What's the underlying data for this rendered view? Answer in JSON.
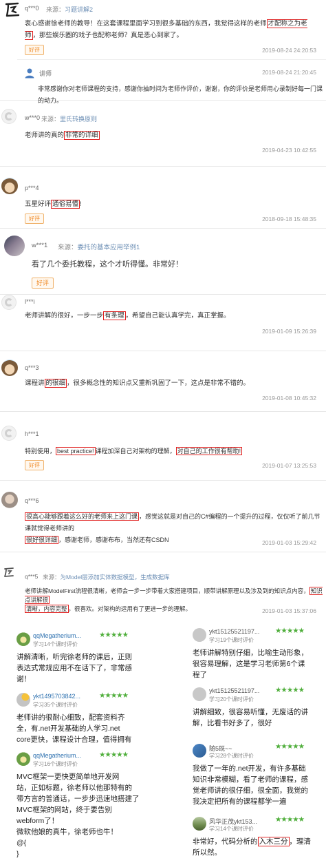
{
  "reviews": [
    {
      "nick": "q***0",
      "source_prefix": "来源：",
      "source_course": "习题讲解2",
      "content": [
        "衷心感谢徐老师的教导！在这套课程里面学习到很多基础的东西，我觉得这样的老师",
        "才配称之为老师",
        "，那些娱乐圈的戏子也配称老师？真是恶心到家了。"
      ],
      "badge": "好评",
      "date": "2019-08-24 24:20:53",
      "reply": {
        "author": "讲师",
        "content": "非常感谢你对老师课程的支持，感谢你抽时间为老师作评价，谢谢，你的评价是老师用心录制好每一门课的动力。",
        "date": "2019-08-24 21:20:45"
      }
    },
    {
      "nick": "w***0",
      "source_prefix": "来源：",
      "source_course": "里氏转换原则",
      "content": [
        "老师讲的真的",
        "非常的详细",
        ""
      ],
      "date": "2019-04-23 10:42:55"
    },
    {
      "nick": "p***4",
      "content": [
        "五星好评",
        "通俗易懂",
        "!"
      ],
      "badge": "好评",
      "date": "2018-09-18 15:48:35"
    },
    {
      "nick": "w***1",
      "source_prefix": "来源：",
      "source_course": "委托的基本应用举例1",
      "content": [
        "看了几个委托教程，这个才听得懂。非常好！"
      ],
      "badge": "好评"
    },
    {
      "nick": "l***i",
      "content": [
        "老师讲解的很好，一步一步",
        "有条理",
        "，希望自己能认真学完，真正掌握。"
      ],
      "date": "2019-01-09 15:26:39"
    },
    {
      "nick": "q***3",
      "content": [
        "课程讲",
        "的很细",
        "，很多概念性的知识点又重新巩固了一下，这点是非常不错的。"
      ],
      "date": "2019-01-08 10:45:32"
    },
    {
      "nick": "h***1",
      "content": [
        "特别使用，",
        "best practice!",
        "课程加深自己对架构的理解，",
        "对自己的工作很有帮助!"
      ],
      "badge": "好评",
      "date": "2019-01-07 13:25:53"
    },
    {
      "nick": "q***6",
      "content_line1": [
        "很高心能够跟着这么好的老师来上这门课",
        "，感觉这就是对自己的C#编程的一个提升的过程，仅仅听了前几节课就觉得老师讲的"
      ],
      "content_line2": [
        "很好很详细",
        "，感谢老师，感谢布布，当然还有CSDN"
      ],
      "date": "2019-01-03 15:29:42"
    },
    {
      "nick": "q***5",
      "source_prefix": "来源：",
      "source_course": "为Model层添加实体数据模型，生成数据库",
      "content_line1": [
        "老师讲解ModelFirst流程很清晰，老师会一步一步带着大家搭建项目，顺带讲解原理以及涉及到的知识点内容，",
        "知识点讲解很"
      ],
      "content_line2": [
        "清晰，内容完整",
        "，很喜欢。对架构的运用有了更进一步的理解。"
      ],
      "date": "2019-01-03 15:37:06"
    }
  ],
  "cards_left": [
    {
      "name": "qqMegatherium...",
      "stars": "★★★★★",
      "count": "学习14个课时评价",
      "text": [
        "讲解清晰，听完徐老师的课后，正则",
        "表达式常规应用不在话下了，非常感",
        "谢！"
      ]
    },
    {
      "name": "ykt1495703842...",
      "stars": "★★★★★",
      "count": "学习35个课时评价",
      "text": [
        "老师讲的很耐心细致，配套资料齐",
        "全，有.net开发基础的人学习.net",
        "core更快，课程设计合理，值得拥有"
      ]
    },
    {
      "name": "qqMegatherium...",
      "stars": "★★★★★",
      "count": "学习16个课时评价",
      "text": [
        "MVC框架一更快更简单地开发网",
        "站，正如标题，徐老师以他那特有的",
        "带方言的普通话，一步步迅速地搭建了",
        "MVC框架的网站，终于要告别",
        "webform了！",
        "微软他娘的真牛，徐老师也牛！",
        "@{",
        "}"
      ]
    }
  ],
  "cards_right": [
    {
      "name": "ykt15125521197...",
      "stars": "★★★★★",
      "count": "学习19个课时评价",
      "text": [
        "老师讲解特别仔细，比喻生动形象，",
        "很容易理解，这是学习老师第6个课",
        "程了"
      ]
    },
    {
      "name": "ykt15125521197...",
      "stars": "★★★★★",
      "count": "学习20个课时评价",
      "text": [
        "讲解细致，很容易听懂，无废话的讲",
        "解，比看书好多了，很好"
      ]
    },
    {
      "name": "随5既~~",
      "stars": "★★★★★",
      "count": "学习28个课时评价",
      "text": [
        "我做了一年的.net开发，有许多基础",
        "知识非常模糊，看了老师的课程，感",
        "觉老师讲的很仔细，很全面，我觉的",
        "我决定把所有的课程都学一遍"
      ]
    },
    {
      "name": "风华正茂ykt153...",
      "stars": "★★★★★",
      "count": "学习14个课时评价",
      "text_pre": "非常好，代码分析的",
      "text_hl": "入木三分",
      "text_post": "，理清",
      "text2": "所以然。"
    }
  ],
  "colors": {
    "highlight": "#e0201f",
    "badge": "#f08c2a",
    "stars": "#4fae3b",
    "link": "#2f72b0"
  }
}
